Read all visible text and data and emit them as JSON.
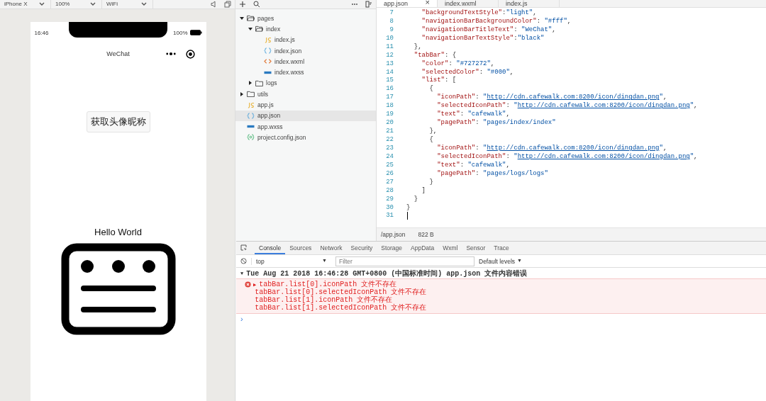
{
  "toolbar": {
    "device": "iPhone X",
    "zoom": "100%",
    "network": "WiFi"
  },
  "simulator": {
    "status_time": "16:46",
    "battery_text": "100%",
    "nav_title": "WeChat",
    "button": "获取头像昵称",
    "hello": "Hello World"
  },
  "file_tree": [
    {
      "name": "pages",
      "kind": "folder",
      "expanded": true,
      "selected": false,
      "children": [
        {
          "name": "index",
          "kind": "folder",
          "expanded": true,
          "selected": false,
          "children": [
            {
              "name": "index.js",
              "kind": "js",
              "selected": false
            },
            {
              "name": "index.json",
              "kind": "json",
              "selected": false
            },
            {
              "name": "index.wxml",
              "kind": "wxml",
              "selected": false
            },
            {
              "name": "index.wxss",
              "kind": "wxss",
              "selected": false
            }
          ]
        },
        {
          "name": "logs",
          "kind": "folder",
          "expanded": false,
          "selected": false
        }
      ]
    },
    {
      "name": "utils",
      "kind": "folder",
      "expanded": false,
      "selected": false
    },
    {
      "name": "app.js",
      "kind": "js",
      "selected": false
    },
    {
      "name": "app.json",
      "kind": "json",
      "selected": true
    },
    {
      "name": "app.wxss",
      "kind": "wxss",
      "selected": false
    },
    {
      "name": "project.config.json",
      "kind": "config",
      "selected": false
    }
  ],
  "editor_tabs": [
    {
      "label": "app.json",
      "selected": true,
      "close": "×"
    },
    {
      "label": "index.wxml",
      "selected": false
    },
    {
      "label": "index.js",
      "selected": false
    }
  ],
  "code_lines": [
    {
      "number": "7",
      "tokens": [
        {
          "kind": "key",
          "text": "    \"backgroundTextStyle\""
        },
        {
          "kind": "punct",
          "text": ":"
        },
        {
          "kind": "string",
          "text": "\"light\""
        },
        {
          "kind": "punct",
          "text": ","
        }
      ]
    },
    {
      "number": "8",
      "tokens": [
        {
          "kind": "key",
          "text": "    \"navigationBarBackgroundColor\""
        },
        {
          "kind": "punct",
          "text": ": "
        },
        {
          "kind": "string",
          "text": "\"#fff\""
        },
        {
          "kind": "punct",
          "text": ","
        }
      ]
    },
    {
      "number": "9",
      "tokens": [
        {
          "kind": "key",
          "text": "    \"navigationBarTitleText\""
        },
        {
          "kind": "punct",
          "text": ": "
        },
        {
          "kind": "string",
          "text": "\"WeChat\""
        },
        {
          "kind": "punct",
          "text": ","
        }
      ]
    },
    {
      "number": "10",
      "tokens": [
        {
          "kind": "key",
          "text": "    \"navigationBarTextStyle\""
        },
        {
          "kind": "punct",
          "text": ":"
        },
        {
          "kind": "string",
          "text": "\"black\""
        }
      ]
    },
    {
      "number": "11",
      "tokens": [
        {
          "kind": "punct",
          "text": "  },"
        }
      ]
    },
    {
      "number": "12",
      "tokens": [
        {
          "kind": "key",
          "text": "  \"tabBar\""
        },
        {
          "kind": "punct",
          "text": ": {"
        }
      ]
    },
    {
      "number": "13",
      "tokens": [
        {
          "kind": "key",
          "text": "    \"color\""
        },
        {
          "kind": "punct",
          "text": ": "
        },
        {
          "kind": "string",
          "text": "\"#727272\""
        },
        {
          "kind": "punct",
          "text": ","
        }
      ]
    },
    {
      "number": "14",
      "tokens": [
        {
          "kind": "key",
          "text": "    \"selectedColor\""
        },
        {
          "kind": "punct",
          "text": ": "
        },
        {
          "kind": "string",
          "text": "\"#000\""
        },
        {
          "kind": "punct",
          "text": ","
        }
      ]
    },
    {
      "number": "15",
      "tokens": [
        {
          "kind": "key",
          "text": "    \"list\""
        },
        {
          "kind": "punct",
          "text": ": ["
        }
      ]
    },
    {
      "number": "16",
      "tokens": [
        {
          "kind": "punct",
          "text": "      {"
        }
      ]
    },
    {
      "number": "17",
      "tokens": [
        {
          "kind": "key",
          "text": "        \"iconPath\""
        },
        {
          "kind": "punct",
          "text": ": "
        },
        {
          "kind": "string",
          "text": "\""
        },
        {
          "kind": "url",
          "text": "http://cdn.cafewalk.com:8200/icon/dingdan.png"
        },
        {
          "kind": "string",
          "text": "\""
        },
        {
          "kind": "punct",
          "text": ","
        }
      ]
    },
    {
      "number": "18",
      "tokens": [
        {
          "kind": "key",
          "text": "        \"selectedIconPath\""
        },
        {
          "kind": "punct",
          "text": ": "
        },
        {
          "kind": "string",
          "text": "\""
        },
        {
          "kind": "url",
          "text": "http://cdn.cafewalk.com:8200/icon/dingdan.png"
        },
        {
          "kind": "string",
          "text": "\""
        },
        {
          "kind": "punct",
          "text": ","
        }
      ]
    },
    {
      "number": "19",
      "tokens": [
        {
          "kind": "key",
          "text": "        \"text\""
        },
        {
          "kind": "punct",
          "text": ": "
        },
        {
          "kind": "string",
          "text": "\"cafewalk\""
        },
        {
          "kind": "punct",
          "text": ","
        }
      ]
    },
    {
      "number": "20",
      "tokens": [
        {
          "kind": "key",
          "text": "        \"pagePath\""
        },
        {
          "kind": "punct",
          "text": ": "
        },
        {
          "kind": "string",
          "text": "\"pages/index/index\""
        }
      ]
    },
    {
      "number": "21",
      "tokens": [
        {
          "kind": "punct",
          "text": "      },"
        }
      ]
    },
    {
      "number": "22",
      "tokens": [
        {
          "kind": "punct",
          "text": "      {"
        }
      ]
    },
    {
      "number": "23",
      "tokens": [
        {
          "kind": "key",
          "text": "        \"iconPath\""
        },
        {
          "kind": "punct",
          "text": ": "
        },
        {
          "kind": "string",
          "text": "\""
        },
        {
          "kind": "url",
          "text": "http://cdn.cafewalk.com:8200/icon/dingdan.png"
        },
        {
          "kind": "string",
          "text": "\""
        },
        {
          "kind": "punct",
          "text": ","
        }
      ]
    },
    {
      "number": "24",
      "tokens": [
        {
          "kind": "key",
          "text": "        \"selectedIconPath\""
        },
        {
          "kind": "punct",
          "text": ": "
        },
        {
          "kind": "string",
          "text": "\""
        },
        {
          "kind": "url",
          "text": "http://cdn.cafewalk.com:8200/icon/dingdan.png"
        },
        {
          "kind": "string",
          "text": "\""
        },
        {
          "kind": "punct",
          "text": ","
        }
      ]
    },
    {
      "number": "25",
      "tokens": [
        {
          "kind": "key",
          "text": "        \"text\""
        },
        {
          "kind": "punct",
          "text": ": "
        },
        {
          "kind": "string",
          "text": "\"cafewalk\""
        },
        {
          "kind": "punct",
          "text": ","
        }
      ]
    },
    {
      "number": "26",
      "tokens": [
        {
          "kind": "key",
          "text": "        \"pagePath\""
        },
        {
          "kind": "punct",
          "text": ": "
        },
        {
          "kind": "string",
          "text": "\"pages/logs/logs\""
        }
      ]
    },
    {
      "number": "27",
      "tokens": [
        {
          "kind": "punct",
          "text": "      }"
        }
      ]
    },
    {
      "number": "28",
      "tokens": [
        {
          "kind": "punct",
          "text": "    ]"
        }
      ]
    },
    {
      "number": "29",
      "tokens": [
        {
          "kind": "punct",
          "text": "  }"
        }
      ]
    },
    {
      "number": "30",
      "tokens": [
        {
          "kind": "punct",
          "text": "}"
        }
      ]
    },
    {
      "number": "31",
      "cursor": true
    }
  ],
  "editor_status": {
    "path": "/app.json",
    "size": "822 B"
  },
  "devtools_tabs": [
    {
      "label": "Console",
      "selected": true
    },
    {
      "label": "Sources",
      "selected": false
    },
    {
      "label": "Network",
      "selected": false
    },
    {
      "label": "Security",
      "selected": false
    },
    {
      "label": "Storage",
      "selected": false
    },
    {
      "label": "AppData",
      "selected": false
    },
    {
      "label": "Wxml",
      "selected": false
    },
    {
      "label": "Sensor",
      "selected": false
    },
    {
      "label": "Trace",
      "selected": false
    }
  ],
  "console_toolbar": {
    "context": "top",
    "context_arrow": "▼",
    "filter_placeholder": "Filter",
    "levels": "Default levels",
    "levels_arrow": "▼"
  },
  "console": {
    "group_toggle": "▼",
    "group_title": "Tue Aug 21 2018 16:46:28 GMT+0800 (中国标准时间)  app.json 文件内容错误",
    "error_toggle": "▶",
    "errors": [
      "tabBar.list[0].iconPath 文件不存在",
      "tabBar.list[0].selectedIconPath 文件不存在",
      "tabBar.list[1].iconPath 文件不存在",
      "tabBar.list[1].selectedIconPath 文件不存在"
    ],
    "prompt": "›"
  }
}
